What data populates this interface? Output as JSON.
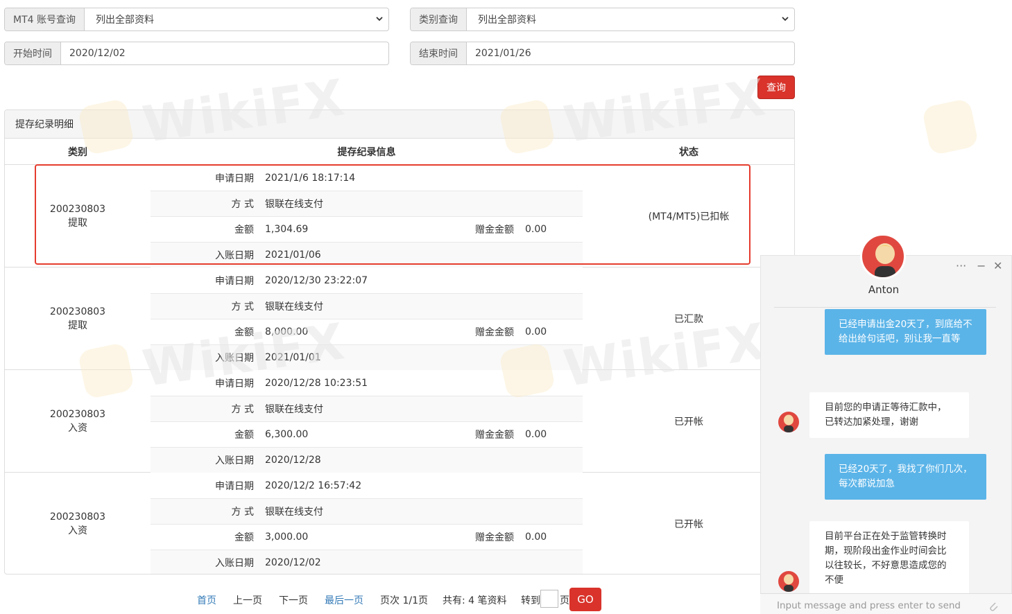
{
  "filters": {
    "account": {
      "label": "MT4 账号查询",
      "value": "列出全部资料"
    },
    "category": {
      "label": "类别查询",
      "value": "列出全部资料"
    },
    "start": {
      "label": "开始时间",
      "value": "2020/12/02"
    },
    "end": {
      "label": "结束时间",
      "value": "2021/01/26"
    },
    "query_button": "查询"
  },
  "panel": {
    "title": "提存纪录明细",
    "columns": [
      "类别",
      "提存纪录信息",
      "状态"
    ],
    "field_labels": {
      "apply_date": "申请日期",
      "method": "方 式",
      "amount": "金额",
      "bonus": "赠金金额",
      "credit_date": "入账日期"
    }
  },
  "records": [
    {
      "account": "200230803",
      "type": "提取",
      "apply_date": "2021/1/6 18:17:14",
      "method": "银联在线支付",
      "amount": "1,304.69",
      "bonus": "0.00",
      "credit_date": "2021/01/06",
      "status": "(MT4/MT5)已扣帐"
    },
    {
      "account": "200230803",
      "type": "提取",
      "apply_date": "2020/12/30 23:22:07",
      "method": "银联在线支付",
      "amount": "8,000.00",
      "bonus": "0.00",
      "credit_date": "2021/01/01",
      "status": "已汇款"
    },
    {
      "account": "200230803",
      "type": "入资",
      "apply_date": "2020/12/28 10:23:51",
      "method": "银联在线支付",
      "amount": "6,300.00",
      "bonus": "0.00",
      "credit_date": "2020/12/28",
      "status": "已开帐"
    },
    {
      "account": "200230803",
      "type": "入资",
      "apply_date": "2020/12/2 16:57:42",
      "method": "银联在线支付",
      "amount": "3,000.00",
      "bonus": "0.00",
      "credit_date": "2020/12/02",
      "status": "已开帐"
    }
  ],
  "pagination": {
    "first": "首页",
    "prev": "上一页",
    "next": "下一页",
    "last": "最后一页",
    "page_info": "页次 1/1页",
    "total": "共有: 4 笔资料",
    "goto": "转到",
    "page_unit": "页",
    "go": "GO"
  },
  "chat": {
    "agent_name": "Anton",
    "controls": {
      "more": "···",
      "minimize": "−",
      "close": "✕"
    },
    "messages": [
      {
        "from": "user",
        "text": "已经申请出金20天了，到底给不给出给句话吧，别让我一直等"
      },
      {
        "from": "agent",
        "text": "目前您的申请正等待汇款中，已转达加紧处理，谢谢"
      },
      {
        "from": "user",
        "text": "已经20天了，我找了你们几次，每次都说加急"
      },
      {
        "from": "agent",
        "text": "目前平台正在处于监管转换时期，现阶段出金作业时间会比以往较长，不好意思造成您的不便"
      }
    ],
    "input_placeholder": "Input message and press enter to send"
  },
  "watermark": "WikiFX",
  "colors": {
    "accent_red": "#d9332b",
    "highlight_red": "#e53c2e",
    "chat_blue": "#5bb4e8",
    "link_blue": "#337ab7"
  }
}
